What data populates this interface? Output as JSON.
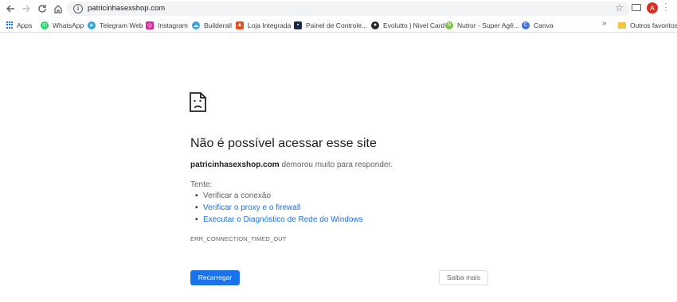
{
  "toolbar": {
    "url": "patricinhasexshop.com",
    "avatar_letter": "A",
    "icons": [
      "back-icon",
      "forward-icon",
      "refresh-icon",
      "home-icon",
      "info-icon",
      "star-icon",
      "cast-icon",
      "menu-icon"
    ]
  },
  "bookmarks": {
    "items": [
      {
        "label": "Apps",
        "icon": "apps-grid-icon",
        "color": "#1a73e8"
      },
      {
        "label": "WhatsApp",
        "icon": "whatsapp-icon",
        "color": "#25d366"
      },
      {
        "label": "Telegram Web",
        "icon": "telegram-icon",
        "color": "#2ca5e0"
      },
      {
        "label": "Instagram",
        "icon": "instagram-icon",
        "color": "#d6249f"
      },
      {
        "label": "Builderall",
        "icon": "builderall-icon",
        "color": "#3aa0e0"
      },
      {
        "label": "Loja Integrada",
        "icon": "loja-integrada-icon",
        "color": "#e94e1b"
      },
      {
        "label": "Painel de Controle...",
        "icon": "painel-icon",
        "color": "#1b2a4a"
      },
      {
        "label": "Evolutto | Nivel Card",
        "icon": "github-icon",
        "color": "#24292e"
      },
      {
        "label": "Nutror - Super Agê...",
        "icon": "nutror-icon",
        "color": "#7cc242"
      },
      {
        "label": "Canva",
        "icon": "canva-icon",
        "color": "#3b6fe0"
      }
    ],
    "other_label": "Outros favoritos"
  },
  "error": {
    "title": "Não é possível acessar esse site",
    "domain": "patricinhasexshop.com",
    "description_suffix": " demorou muito para responder.",
    "try_label": "Tente:",
    "suggestions": [
      {
        "text": "Verificar a conexão",
        "link": false
      },
      {
        "text": "Verificar o proxy e o firewall",
        "link": true
      },
      {
        "text": "Executar o Diagnóstico de Rede do Windows",
        "link": true
      }
    ],
    "code": "ERR_CONNECTION_TIMED_OUT",
    "reload_label": "Recarregar",
    "more_label": "Saiba mais"
  },
  "colors": {
    "accent": "#1a73e8",
    "text": "#202124",
    "secondary_text": "#5f6368",
    "avatar": "#d93025"
  }
}
